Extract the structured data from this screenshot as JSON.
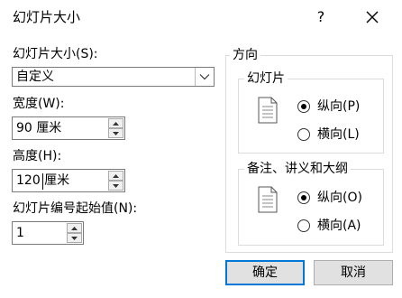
{
  "window": {
    "title": "幻灯片大小",
    "help_icon": "question-mark-icon",
    "close_icon": "close-icon"
  },
  "slide_size": {
    "label": "幻灯片大小(S):",
    "selected": "自定义",
    "dropdown_icon": "chevron-down-icon"
  },
  "width": {
    "label": "宽度(W):",
    "value": "90 厘米"
  },
  "height": {
    "label": "高度(H):",
    "value": "120 厘米"
  },
  "start_number": {
    "label": "幻灯片编号起始值(N):",
    "value": "1"
  },
  "orientation": {
    "title": "方向",
    "slides": {
      "title": "幻灯片",
      "icon": "document-icon",
      "options": [
        {
          "label": "纵向(P)",
          "selected": true
        },
        {
          "label": "横向(L)",
          "selected": false
        }
      ]
    },
    "notes": {
      "title": "备注、讲义和大纲",
      "icon": "document-icon",
      "options": [
        {
          "label": "纵向(O)",
          "selected": true
        },
        {
          "label": "横向(A)",
          "selected": false
        }
      ]
    }
  },
  "buttons": {
    "ok": "确定",
    "cancel": "取消"
  }
}
